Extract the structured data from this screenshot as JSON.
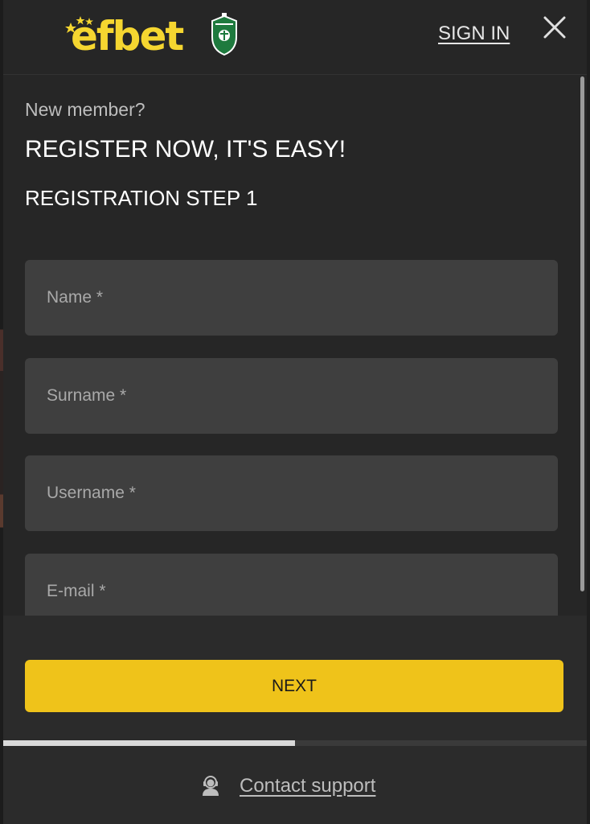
{
  "header": {
    "logo_text": "efbet",
    "sign_in_label": "SIGN IN",
    "close_label": "close"
  },
  "registration": {
    "new_member": "New member?",
    "title": "REGISTER NOW, IT'S EASY!",
    "step_title": "REGISTRATION STEP 1",
    "fields": [
      {
        "name": "name",
        "placeholder": "Name *",
        "value": ""
      },
      {
        "name": "surname",
        "placeholder": "Surname *",
        "value": ""
      },
      {
        "name": "username",
        "placeholder": "Username *",
        "value": ""
      },
      {
        "name": "email",
        "placeholder": "E-mail *",
        "value": ""
      }
    ],
    "next_label": "NEXT",
    "progress": 0.5
  },
  "support": {
    "label": "Contact support"
  },
  "colors": {
    "brand_yellow": "#f5d630",
    "button_yellow": "#efc31a",
    "background": "#262626",
    "field_bg": "#3f3f3f"
  }
}
